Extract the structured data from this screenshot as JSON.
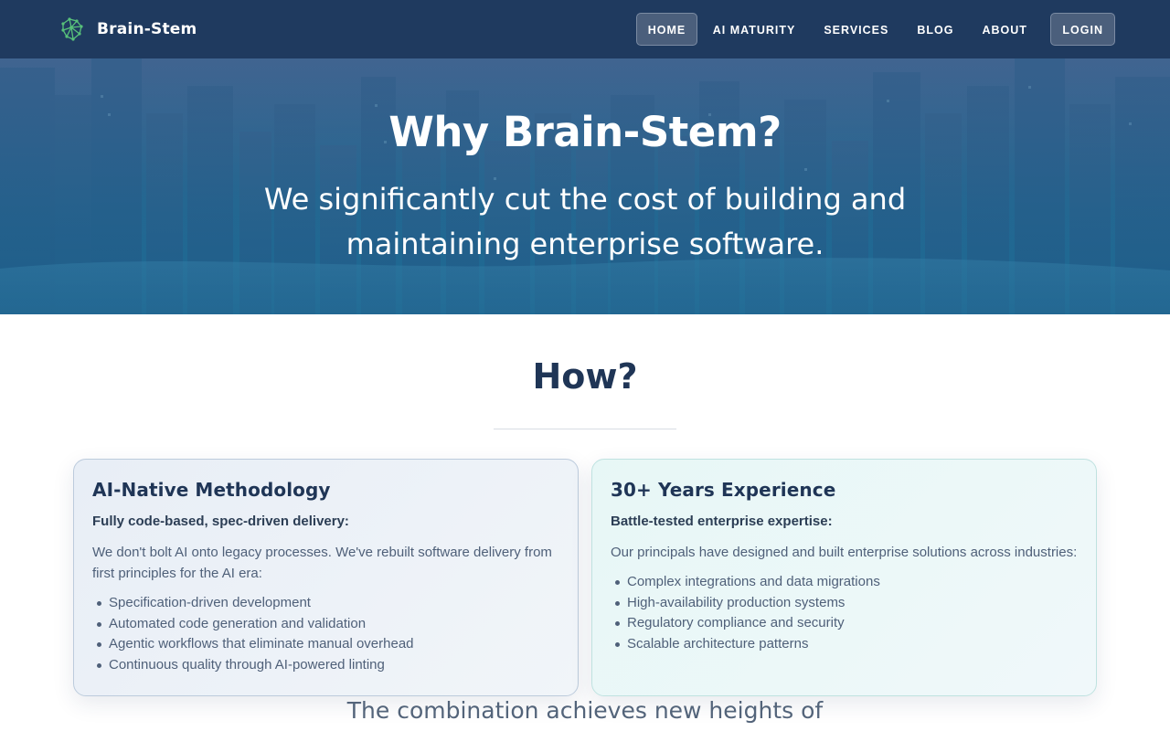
{
  "nav": {
    "brand": "Brain-Stem",
    "logo_icon": "brain-network-icon",
    "links": [
      "HOME",
      "AI MATURITY",
      "SERVICES",
      "BLOG",
      "ABOUT"
    ],
    "active": "HOME",
    "login": "LOGIN"
  },
  "hero": {
    "title": "Why Brain-Stem?",
    "subtitle": "We significantly cut the cost of building and maintaining enterprise software."
  },
  "how": {
    "title": "How?"
  },
  "cards": [
    {
      "title": "AI-Native Methodology",
      "strong": "Fully code-based, spec-driven delivery:",
      "text": "We don't bolt AI onto legacy processes. We've rebuilt software delivery from first principles for the AI era:",
      "items": [
        "Specification-driven development",
        "Automated code generation and validation",
        "Agentic workflows that eliminate manual overhead",
        "Continuous quality through AI-powered linting"
      ]
    },
    {
      "title": "30+ Years Experience",
      "strong": "Battle-tested enterprise expertise:",
      "text": "Our principals have designed and built enterprise solutions across industries:",
      "items": [
        "Complex integrations and data migrations",
        "High-availability production systems",
        "Regulatory compliance and security",
        "Scalable architecture patterns"
      ]
    }
  ],
  "combination": "The combination achieves new heights of",
  "colors": {
    "navbar": "#1f3a5f",
    "heading": "#1f3556",
    "body_text": "#4f6079",
    "logo_accent": "#58c27a"
  }
}
